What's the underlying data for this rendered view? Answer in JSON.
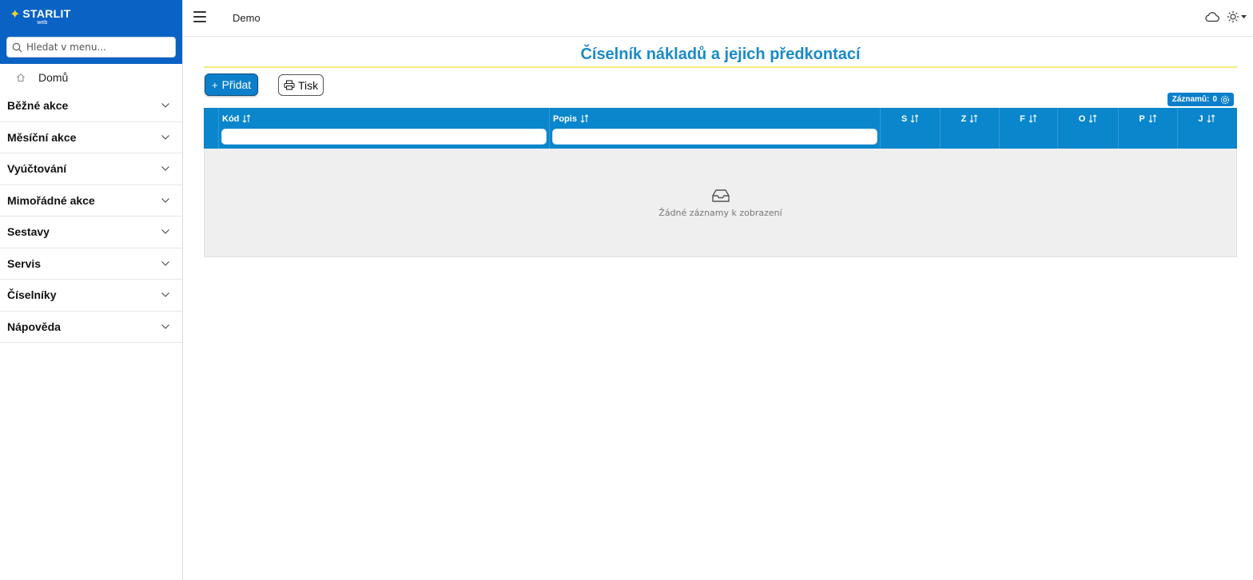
{
  "brand": {
    "name": "STARLIT",
    "sub": "web"
  },
  "search": {
    "placeholder": "Hledat v menu..."
  },
  "home": {
    "label": "Domů"
  },
  "menu": [
    {
      "label": "Běžné akce"
    },
    {
      "label": "Měsíční akce"
    },
    {
      "label": "Vyúčtování"
    },
    {
      "label": "Mimořádné akce"
    },
    {
      "label": "Sestavy"
    },
    {
      "label": "Servis"
    },
    {
      "label": "Číselníky"
    },
    {
      "label": "Nápověda"
    }
  ],
  "topbar": {
    "breadcrumb": "Demo"
  },
  "page": {
    "title": "Číselník nákladů a jejich předkontací",
    "add_label": "Přidat",
    "print_label": "Tisk",
    "records_label": "Záznamů:",
    "records_count": "0"
  },
  "table": {
    "columns": [
      "Kód",
      "Popis",
      "S",
      "Z",
      "F",
      "O",
      "P",
      "J"
    ],
    "empty_text": "Žádné záznamy k zobrazení"
  },
  "colors": {
    "brand": "#0a62c4",
    "accent": "#0a86cc",
    "title": "#1a8ac8",
    "underline": "#f3ed7a",
    "star": "#f3d329"
  }
}
